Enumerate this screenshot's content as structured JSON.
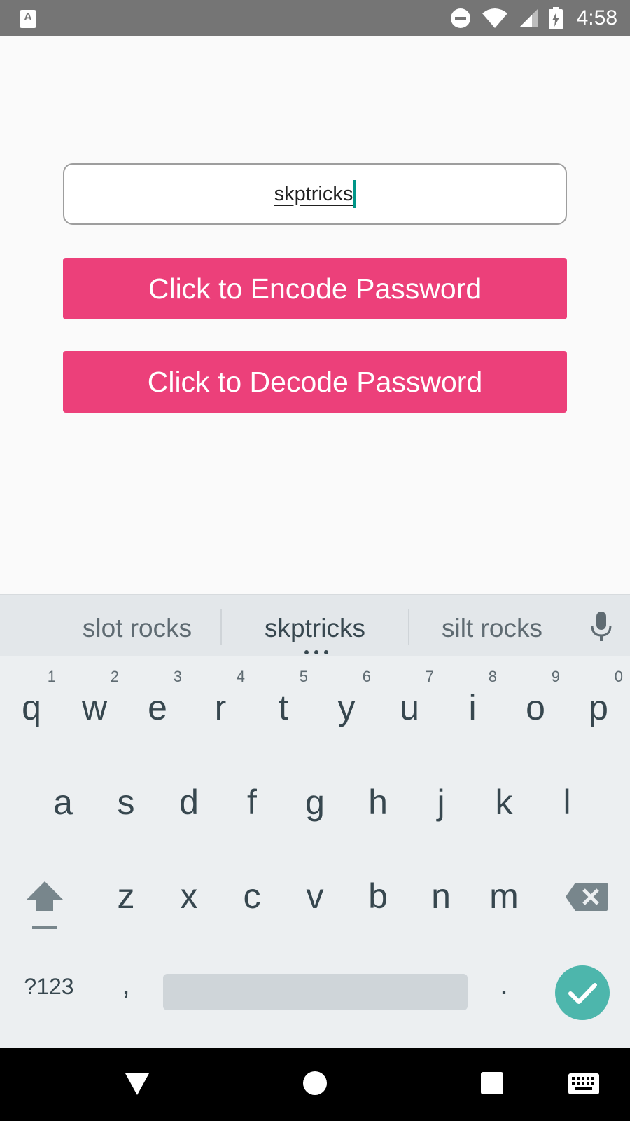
{
  "status_bar": {
    "time": "4:58",
    "app_icon_letter": "A"
  },
  "password_field": {
    "value": "skptricks"
  },
  "buttons": {
    "encode_label": "Click to Encode Password",
    "decode_label": "Click to Decode Password"
  },
  "colors": {
    "accent": "#ec407a",
    "cursor": "#009688",
    "status_bar": "#757575",
    "done_key": "#4db6ac"
  },
  "keyboard": {
    "suggestions": [
      "slot rocks",
      "skptricks",
      "silt rocks"
    ],
    "row1": [
      {
        "key": "q",
        "hint": "1"
      },
      {
        "key": "w",
        "hint": "2"
      },
      {
        "key": "e",
        "hint": "3"
      },
      {
        "key": "r",
        "hint": "4"
      },
      {
        "key": "t",
        "hint": "5"
      },
      {
        "key": "y",
        "hint": "6"
      },
      {
        "key": "u",
        "hint": "7"
      },
      {
        "key": "i",
        "hint": "8"
      },
      {
        "key": "o",
        "hint": "9"
      },
      {
        "key": "p",
        "hint": "0"
      }
    ],
    "row2": [
      "a",
      "s",
      "d",
      "f",
      "g",
      "h",
      "j",
      "k",
      "l"
    ],
    "row3": [
      "z",
      "x",
      "c",
      "v",
      "b",
      "n",
      "m"
    ],
    "symbols_label": "?123",
    "comma": ",",
    "period": ".",
    "icons": [
      "shift-icon",
      "backspace-icon",
      "mic-icon",
      "check-icon"
    ]
  },
  "nav_bar": {
    "icons": [
      "back-icon",
      "home-icon",
      "recents-icon",
      "keyboard-switch-icon"
    ]
  }
}
